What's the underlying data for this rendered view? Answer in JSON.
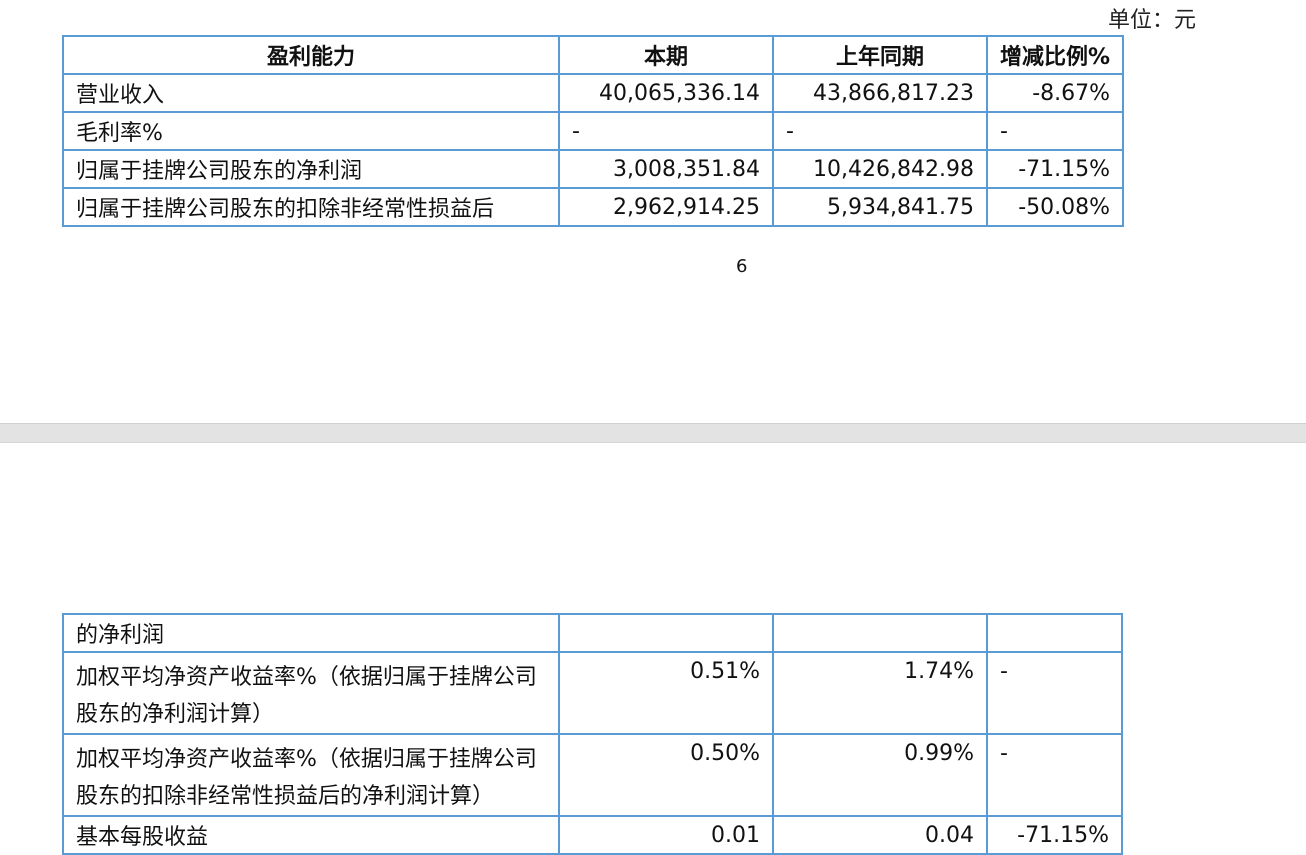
{
  "unit_label": "单位：元",
  "page_number": "6",
  "table1": {
    "headers": [
      "盈利能力",
      "本期",
      "上年同期",
      "增减比例%"
    ],
    "rows": [
      [
        "营业收入",
        "40,065,336.14",
        "43,866,817.23",
        "-8.67%"
      ],
      [
        "毛利率%",
        "-",
        "-",
        "-"
      ],
      [
        "归属于挂牌公司股东的净利润",
        "3,008,351.84",
        "10,426,842.98",
        "-71.15%"
      ],
      [
        "归属于挂牌公司股东的扣除非经常性损益后",
        "2,962,914.25",
        "5,934,841.75",
        "-50.08%"
      ]
    ]
  },
  "table2": {
    "rows": [
      [
        "的净利润",
        "",
        "",
        ""
      ],
      [
        "加权平均净资产收益率%（依据归属于挂牌公司股东的净利润计算）",
        "0.51%",
        "1.74%",
        "-"
      ],
      [
        "加权平均净资产收益率%（依据归属于挂牌公司股东的扣除非经常性损益后的净利润计算）",
        "0.50%",
        "0.99%",
        "-"
      ],
      [
        "基本每股收益",
        "0.01",
        "0.04",
        "-71.15%"
      ]
    ]
  }
}
